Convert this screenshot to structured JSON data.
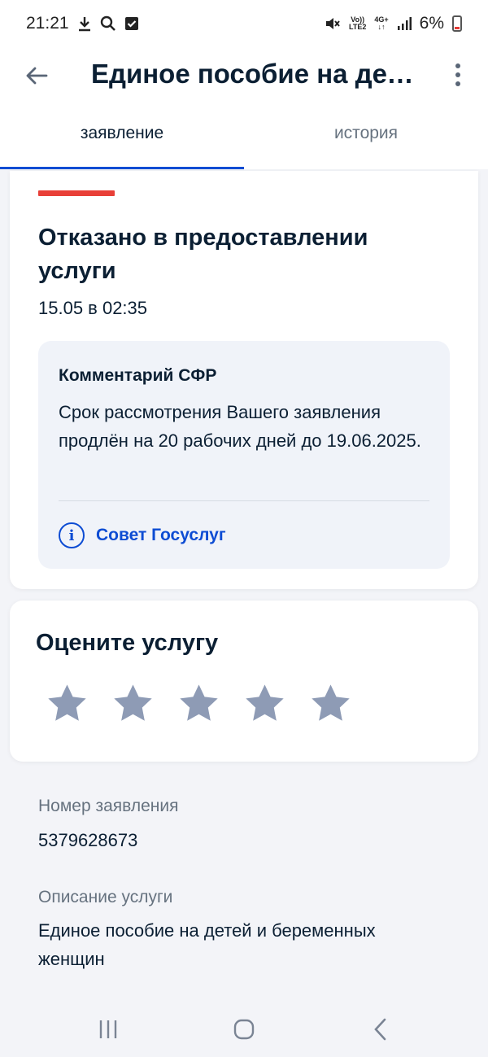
{
  "status_bar": {
    "time": "21:21",
    "battery": "6%",
    "network_top": "Vo))",
    "network_bottom": "LTE2",
    "signal_label": "4G+"
  },
  "app_bar": {
    "title": "Единое пособие на дет…",
    "back_icon": "arrow-left-icon",
    "menu_icon": "more-vertical-icon"
  },
  "tabs": [
    {
      "label": "заявление",
      "active": true
    },
    {
      "label": "история",
      "active": false
    }
  ],
  "status_card": {
    "status": "Отказано в предоставлении услуги",
    "date": "15.05 в 02:35",
    "status_color": "#e83f38",
    "comment": {
      "title": "Комментарий СФР",
      "text": "Срок рассмотрения Вашего заявления продлён на 20 рабочих дней до 19.06.2025.",
      "advice_label": "Совет Госуслуг",
      "advice_icon": "info-icon"
    }
  },
  "rating_card": {
    "title": "Оцените услугу",
    "stars": 5,
    "selected": 0,
    "star_color": "#8e9bb5"
  },
  "details": {
    "number_label": "Номер заявления",
    "number_value": "5379628673",
    "description_label": "Описание услуги",
    "description_value": "Единое пособие на детей и беременных женщин"
  },
  "accent_color": "#0d4cd3"
}
